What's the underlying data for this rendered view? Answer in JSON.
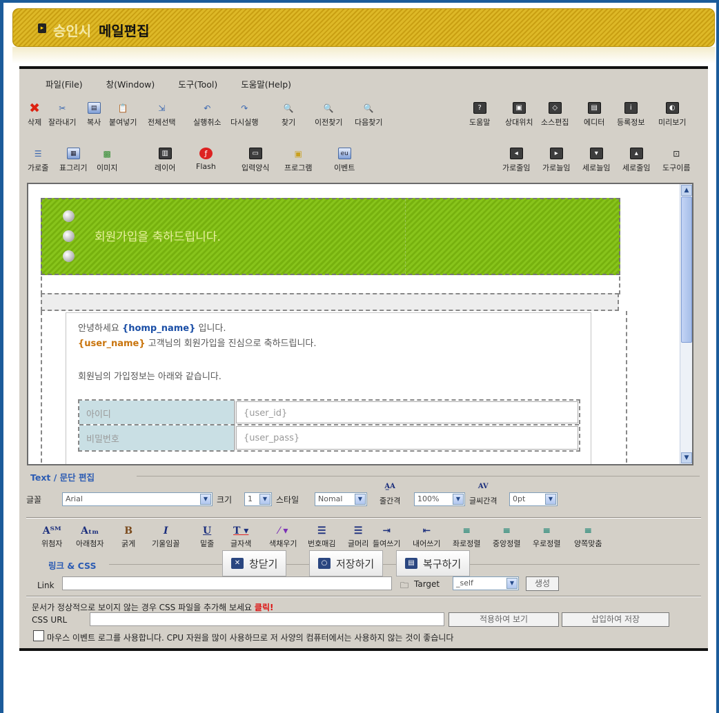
{
  "header": {
    "prefix": "승인시",
    "title": "메일편집"
  },
  "menu": [
    "파일(File)",
    "창(Window)",
    "도구(Tool)",
    "도움말(Help)"
  ],
  "toolbar1": [
    {
      "label": "삭제",
      "icon": "delete-icon"
    },
    {
      "label": "잘라내기",
      "icon": "scissors-icon"
    },
    {
      "label": "복사",
      "icon": "copy-icon"
    },
    {
      "label": "붙여넣기",
      "icon": "paste-icon"
    },
    {
      "label": "전체선택",
      "icon": "select-all-icon"
    },
    {
      "label": "실행취소",
      "icon": "undo-icon"
    },
    {
      "label": "다시실행",
      "icon": "redo-icon"
    },
    {
      "label": "찾기",
      "icon": "find-icon"
    },
    {
      "label": "이전찾기",
      "icon": "find-prev-icon"
    },
    {
      "label": "다음찾기",
      "icon": "find-next-icon"
    },
    {
      "label": "도움말",
      "icon": "help-icon"
    },
    {
      "label": "상대위치",
      "icon": "relative-position-icon"
    },
    {
      "label": "소스편집",
      "icon": "source-edit-icon"
    },
    {
      "label": "에디터",
      "icon": "editor-icon"
    },
    {
      "label": "등록정보",
      "icon": "info-icon"
    },
    {
      "label": "미리보기",
      "icon": "preview-icon"
    }
  ],
  "toolbar2": [
    {
      "label": "가로줄",
      "icon": "horizontal-line-icon"
    },
    {
      "label": "표그리기",
      "icon": "table-icon"
    },
    {
      "label": "이미지",
      "icon": "image-icon"
    },
    {
      "label": "레이어",
      "icon": "layer-icon"
    },
    {
      "label": "Flash",
      "icon": "flash-icon"
    },
    {
      "label": "입력양식",
      "icon": "form-icon"
    },
    {
      "label": "프로그램",
      "icon": "program-icon"
    },
    {
      "label": "이벤트",
      "icon": "event-icon"
    },
    {
      "label": "가로줄임",
      "icon": "shrink-width-icon"
    },
    {
      "label": "가로늘임",
      "icon": "expand-width-icon"
    },
    {
      "label": "세로늘임",
      "icon": "expand-height-icon"
    },
    {
      "label": "세로줄임",
      "icon": "shrink-height-icon"
    },
    {
      "label": "도구이름",
      "icon": "tool-name-icon"
    }
  ],
  "content": {
    "banner": "회원가입을 축하드립니다.",
    "greeting_pre": "안녕하세요 ",
    "homp_name": "{homp_name}",
    "greeting_post": " 입니다.",
    "user_name": "{user_name}",
    "congrats": " 고객님의 회원가입을 진심으로 축하드립니다.",
    "info_line": "회원님의 가입정보는 아래와 같습니다.",
    "rows": [
      {
        "label": "아이디",
        "value": "{user_id}"
      },
      {
        "label": "비밀번호",
        "value": "{user_pass}"
      }
    ]
  },
  "text_panel": {
    "legend": "Text / 문단 편집",
    "font_label": "글꼴",
    "font_value": "Arial",
    "size_label": "크기",
    "size_value": "1",
    "style_label": "스타일",
    "style_value": "Nomal",
    "line_spacing_label": "줄간격",
    "line_spacing_value": "100%",
    "letter_spacing_label": "글씨간격",
    "letter_spacing_value": "0pt"
  },
  "format_buttons": [
    {
      "label": "위첨자",
      "glyph": "A™"
    },
    {
      "label": "아래첨자",
      "glyph": "A™"
    },
    {
      "label": "굵게",
      "glyph": "B"
    },
    {
      "label": "기울임꼴",
      "glyph": "I"
    },
    {
      "label": "밑줄",
      "glyph": "U"
    },
    {
      "label": "글자색",
      "glyph": "T"
    },
    {
      "label": "색채우기",
      "glyph": "∠"
    },
    {
      "label": "번호매김",
      "glyph": "☰"
    },
    {
      "label": "글머리",
      "glyph": "☰"
    },
    {
      "label": "들여쓰기",
      "glyph": "☰"
    },
    {
      "label": "내어쓰기",
      "glyph": "☰"
    },
    {
      "label": "좌로정렬",
      "glyph": "≡"
    },
    {
      "label": "중앙정렬",
      "glyph": "≡"
    },
    {
      "label": "우로정렬",
      "glyph": "≡"
    },
    {
      "label": "양쪽맞춤",
      "glyph": "≡"
    }
  ],
  "link_panel": {
    "legend": "링크 & CSS",
    "link_label": "Link",
    "link_value": "",
    "target_label": "Target",
    "target_value": "_self",
    "create_button": "생성"
  },
  "css_panel": {
    "notice": "문서가 정상적으로 보이지 않는 경우 CSS 파일을 추가해 보세요",
    "click": "클릭!",
    "url_label": "CSS URL",
    "url_value": "",
    "apply_button": "적용하여 보기",
    "insert_button": "삽입하여 저장",
    "checkbox_label": "마우스 이벤트 로그를 사용합니다. CPU 자원을 많이 사용하므로 저 사양의 컴퓨터에서는 사용하지 않는 것이 좋습니다"
  },
  "bottom_buttons": {
    "close": "창닫기",
    "save": "저장하기",
    "restore": "복구하기"
  },
  "colors": {
    "frame": "#1b5b9a",
    "header": "#d4b020",
    "banner": "#7fba14",
    "accent_blue": "#1a4ea6",
    "accent_orange": "#c9740c",
    "legend": "#2b5bb3"
  }
}
